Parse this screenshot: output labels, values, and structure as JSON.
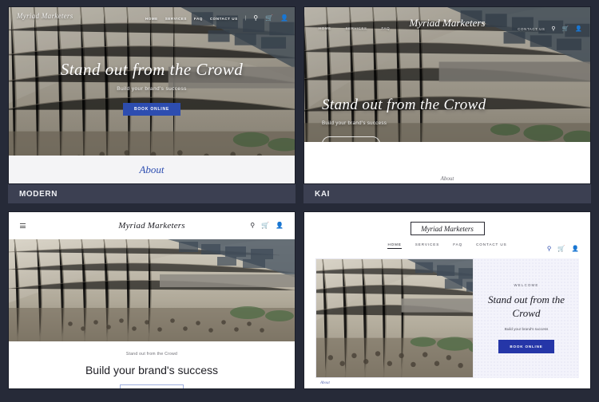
{
  "brand": {
    "name": "Myriad Marketers"
  },
  "colors": {
    "background": "#262a38",
    "label_bar": "#3c4052",
    "accent_blue": "#2d4db0",
    "button_blue": "#2536a8",
    "panel_lavender": "#f3f3fb"
  },
  "hero": {
    "headline": "Stand out from the Crowd",
    "subtext": "Build your brand's success",
    "button": "BOOK ONLINE",
    "welcome": "WELCOME"
  },
  "nav": {
    "home": "HOME",
    "services": "SERVICES",
    "faq": "FAQ",
    "contact": "CONTACT US",
    "separator": "|"
  },
  "icons": {
    "search": "⌕",
    "cart": "🛒",
    "account": "👤",
    "hamburger": "menu-icon"
  },
  "sections": {
    "about": "About"
  },
  "templates": [
    {
      "id": "modern",
      "label": "MODERN"
    },
    {
      "id": "kai",
      "label": "KAI"
    },
    {
      "id": "three",
      "label": ""
    },
    {
      "id": "four",
      "label": ""
    }
  ]
}
